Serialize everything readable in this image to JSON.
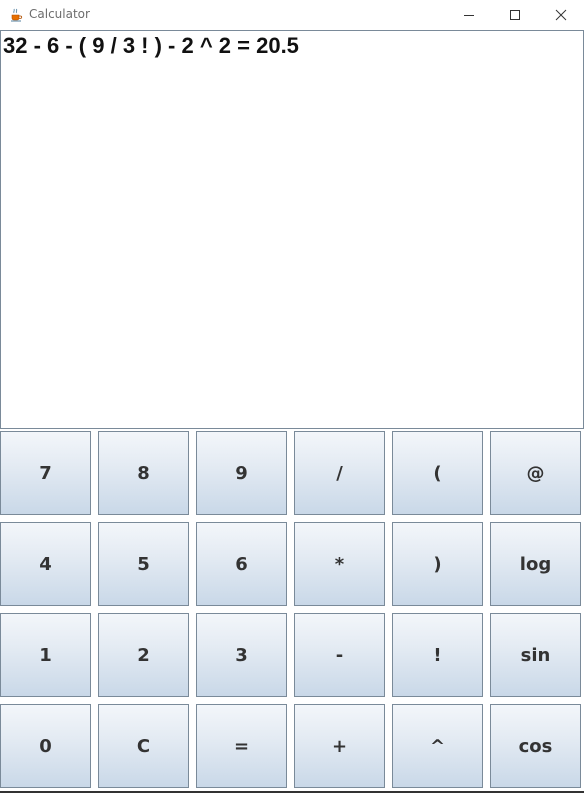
{
  "window": {
    "title": "Calculator",
    "icon": "java-cup-icon"
  },
  "display": {
    "text": "32 - 6 - ( 9 / 3 ! ) - 2 ^ 2 = 20.5"
  },
  "keys": [
    [
      "7",
      "8",
      "9",
      "/",
      "(",
      "@"
    ],
    [
      "4",
      "5",
      "6",
      "*",
      ")",
      "log"
    ],
    [
      "1",
      "2",
      "3",
      "-",
      "!",
      "sin"
    ],
    [
      "0",
      "C",
      "=",
      "+",
      "^",
      "cos"
    ]
  ],
  "colors": {
    "key_gradient_top": "#f3f6fa",
    "key_gradient_bottom": "#c9d8e8",
    "key_border": "#7a8a99",
    "key_text": "#333333"
  }
}
